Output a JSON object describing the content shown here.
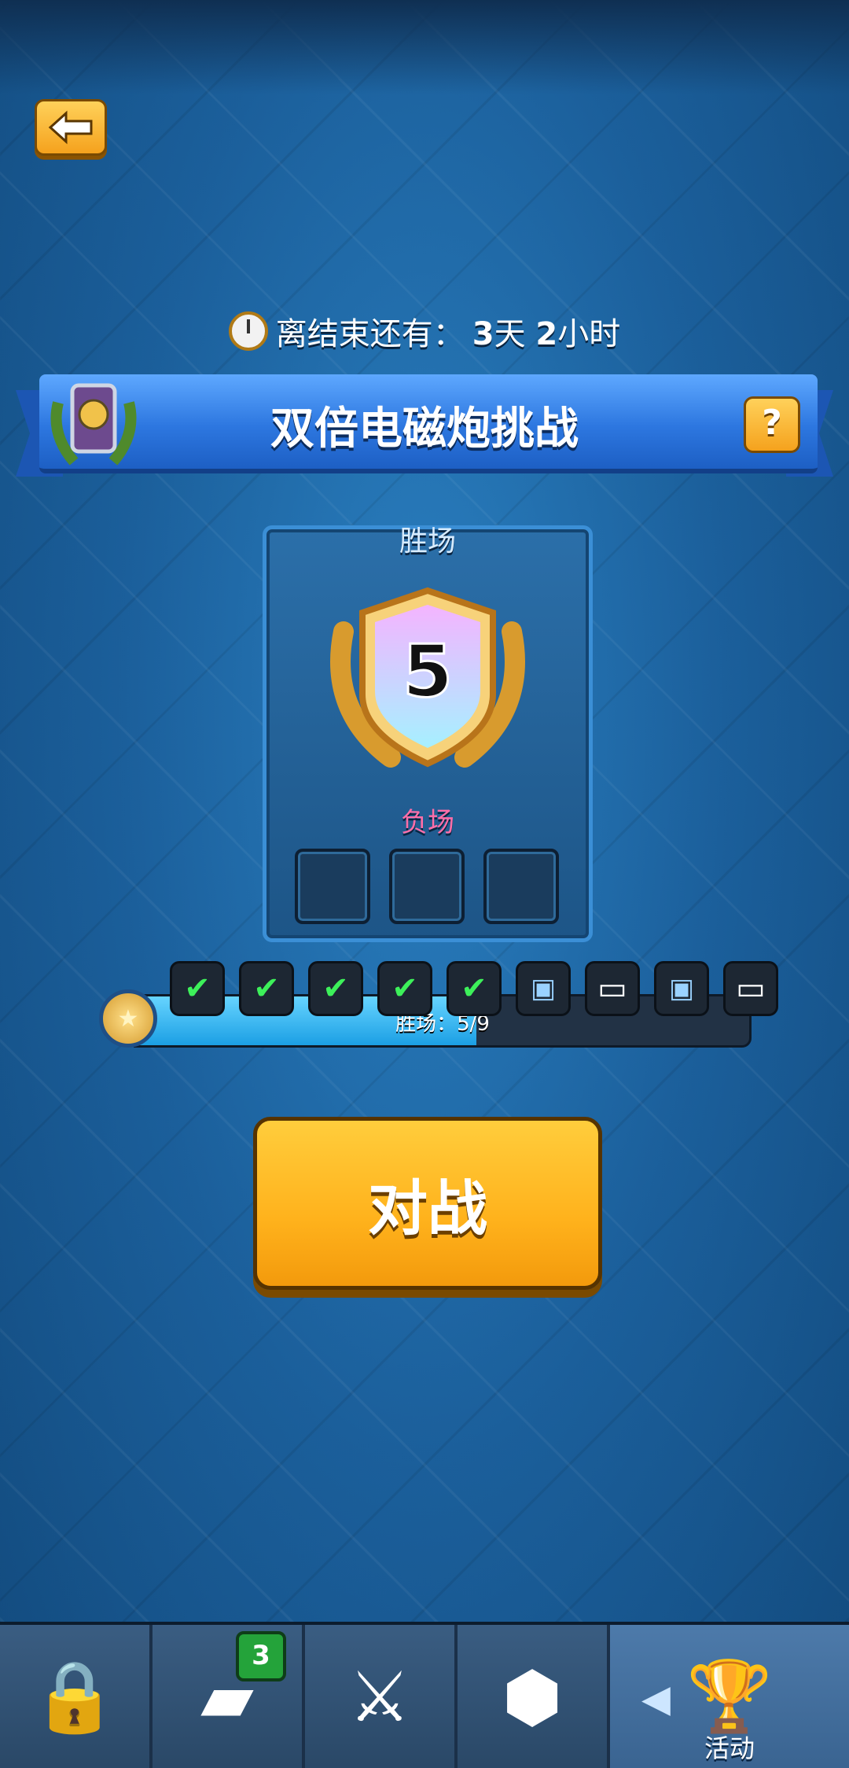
{
  "header": {
    "back_icon": "back-arrow-icon",
    "timer_prefix": "离结束还有：",
    "timer_days": "3",
    "timer_day_unit": "天",
    "timer_hours": "2",
    "timer_hour_unit": "小时"
  },
  "challenge": {
    "title": "双倍电磁炮挑战",
    "help_label": "?"
  },
  "scoreboard": {
    "wins_label": "胜场",
    "wins_value": "5",
    "loss_label": "负场",
    "loss_slots": 3
  },
  "progress": {
    "text": "胜场：5/9",
    "wins": 5,
    "total": 9,
    "nodes": [
      "check",
      "check",
      "check",
      "check",
      "check",
      "chest",
      "card",
      "chest",
      "card"
    ]
  },
  "battle_button": {
    "label": "对战"
  },
  "bottom_nav": {
    "tabs": [
      {
        "icon": "shop-chest-icon"
      },
      {
        "icon": "cards-icon",
        "badge": "3"
      },
      {
        "icon": "battle-swords-icon"
      },
      {
        "icon": "clan-icon"
      },
      {
        "icon": "events-icon",
        "label": "活动",
        "active": true
      }
    ]
  },
  "colors": {
    "accent": "#ffb21c",
    "banner": "#2d77e0",
    "win": "#3df05a",
    "loss": "#ff6ea8"
  }
}
